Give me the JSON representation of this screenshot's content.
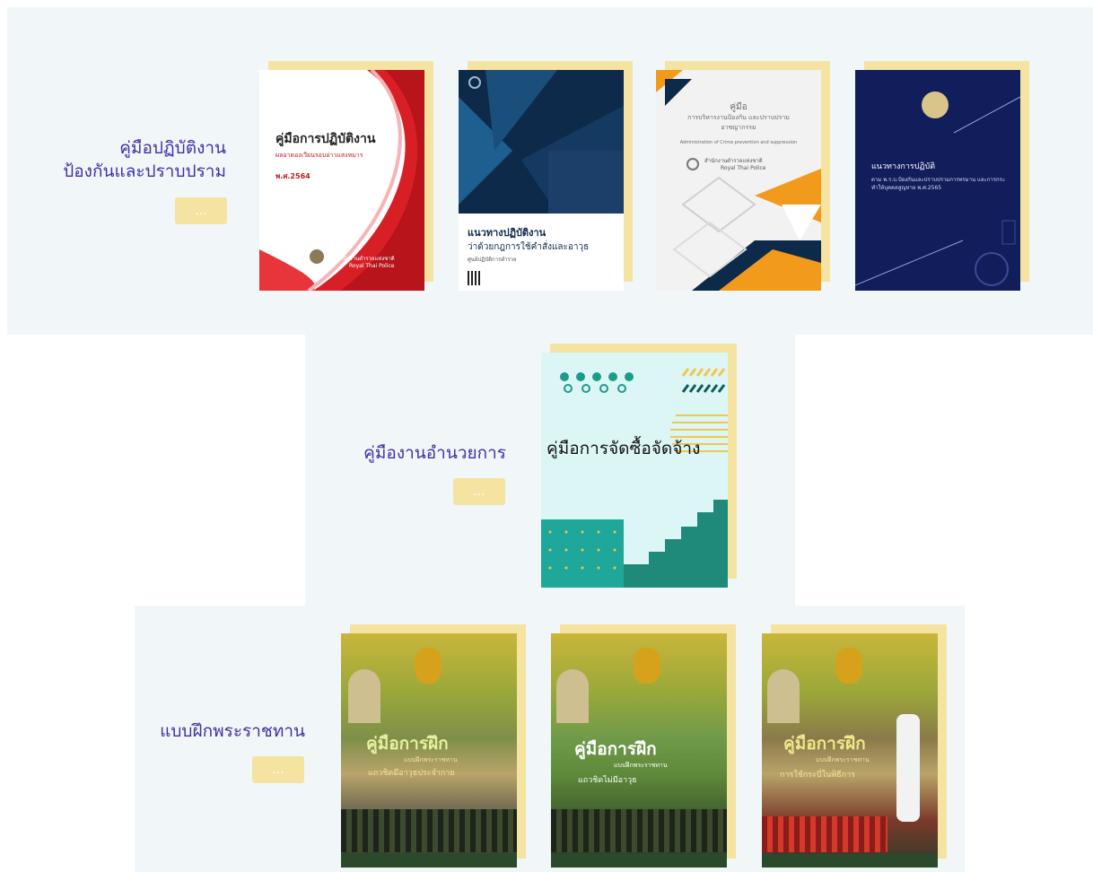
{
  "sections": [
    {
      "title_lines": [
        "คู่มือปฏิบัติงาน",
        "ป้องกันและปราบปราม"
      ],
      "more_label": "...",
      "books": [
        {
          "title": "คู่มือการปฏิบัติงาน",
          "subtitle": "ผลอาตองเวียนรอบอ่าวแสงหมาร",
          "year": "พ.ศ.2564",
          "org": "สำนักงานตำรวจแห่งชาติ",
          "org_en": "Royal Thai Police"
        },
        {
          "title": "แนวทางปฏิบัติงาน",
          "subtitle": "ว่าด้วยกฎการใช้คำสั่งและอาวุธ",
          "caption": "ศูนย์ปฏิบัติการตำรวจ"
        },
        {
          "title": "คู่มือ",
          "subtitle": "การบริหารงานป้องกัน และปราบปรามอาชญากรรม",
          "caption_en": "Administration of Crime prevention and suppression",
          "org": "สำนักงานตำรวจแห่งชาติ",
          "org_en": "Royal Thai Police"
        },
        {
          "title": "แนวทางการปฏิบัติ",
          "subtitle": "ตาม พ.ร.บ.ป้องกันและปราบปรามการทรมาน และการกระทำให้บุคคลสูญหาย พ.ศ.2565"
        }
      ]
    },
    {
      "title_lines": [
        "คู่มืองานอำนวยการ"
      ],
      "more_label": "...",
      "books": [
        {
          "title": "คู่มือการจัดซื้อจัดจ้าง"
        }
      ]
    },
    {
      "title_lines": [
        "แบบฝึกพระราชทาน"
      ],
      "more_label": "...",
      "books": [
        {
          "title": "คู่มือการฝึก",
          "subtitle": "แบบฝึกพระราชทาน",
          "caption": "แถวชิดมีอาวุธประจำกาย"
        },
        {
          "title": "คู่มือการฝึก",
          "subtitle": "แบบฝึกพระราชทาน",
          "caption": "แถวชิดไม่มีอาวุธ"
        },
        {
          "title": "คู่มือการฝึก",
          "subtitle": "แบบฝึกพระราชทาน",
          "caption": "การใช้กระบี่ในพิธีการ"
        }
      ]
    }
  ],
  "colors": {
    "accent": "#f4e3a1",
    "title": "#3a33a8",
    "panel": "#f1f7f9"
  }
}
